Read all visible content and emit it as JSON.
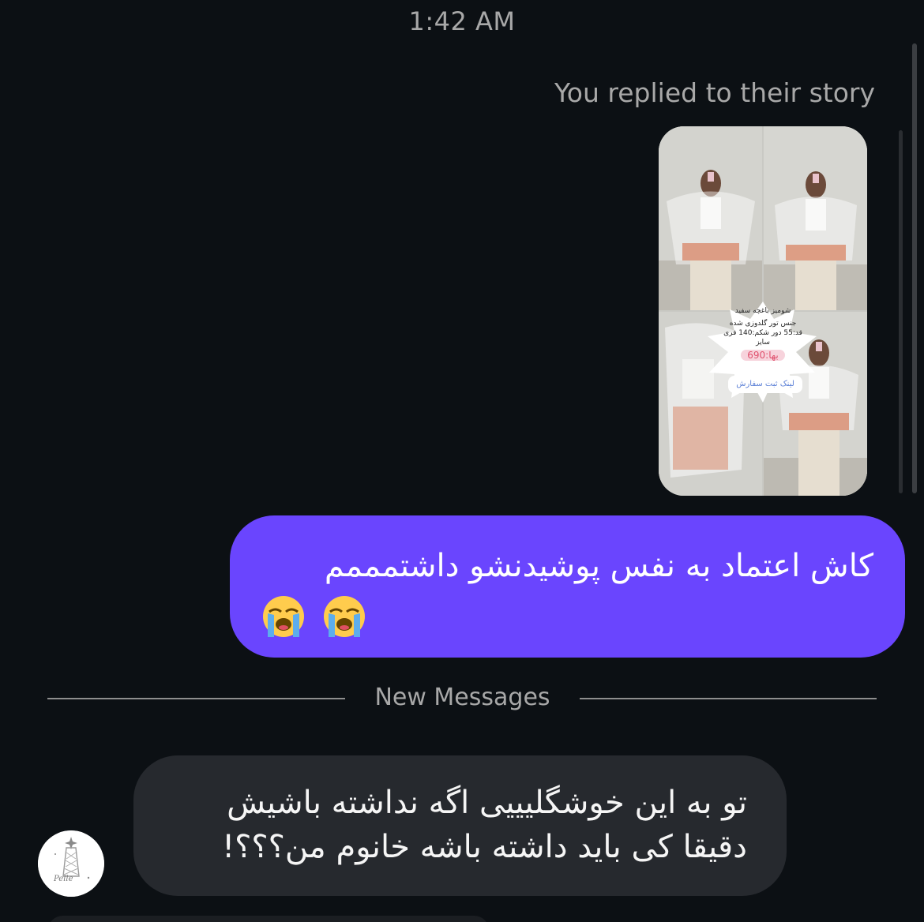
{
  "header": {
    "time": "1:42 AM"
  },
  "story_reply": {
    "note": "You replied to their story",
    "image_icon": "story-thumbnail",
    "story_caption_title": "شومیز باغچه سفید",
    "story_caption_body": "جنس تور گلدوزی شده قد:55 دور شکم:140 فری سایز",
    "story_price": "بها:690",
    "story_link": "لینک ثبت سفارش"
  },
  "outgoing_message": {
    "text": "کاش اعتماد به نفس پوشیدنشو داشتمممم",
    "emojis": [
      "loudly-crying-face-icon",
      "loudly-crying-face-icon"
    ],
    "bubble_color": "#6a45fe"
  },
  "divider": {
    "label": "New Messages"
  },
  "incoming_message": {
    "text": "تو به این خوشگلیییی اگه نداشته باشیش دقیقا کی باید داشته باشه خانوم من؟؟؟!",
    "avatar_icon": "profile-avatar",
    "avatar_label": "Pelle",
    "bubble_color": "#26292e"
  },
  "theme": {
    "background": "#0c1014",
    "muted_text": "#a8a8a8"
  }
}
